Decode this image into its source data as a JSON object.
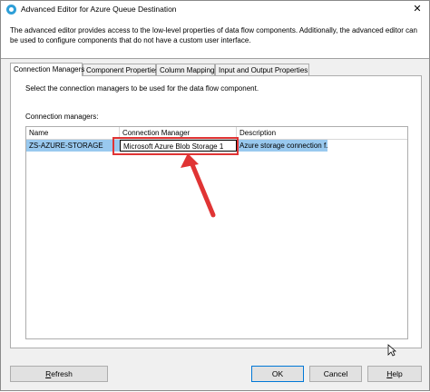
{
  "window": {
    "title": "Advanced Editor for Azure Queue Destination",
    "close_glyph": "✕"
  },
  "description": "The advanced editor provides access to the low-level properties of data flow components. Additionally, the advanced editor can be used to configure components that do not have a custom user interface.",
  "tabs": [
    {
      "label": "Connection Managers",
      "active": true
    },
    {
      "label": "Component Properties",
      "active": false
    },
    {
      "label": "Column Mappings",
      "active": false
    },
    {
      "label": "Input and Output Properties",
      "active": false
    }
  ],
  "panel": {
    "instruction": "Select the connection managers to be used for the data flow component.",
    "grid_label": "Connection managers:",
    "columns": [
      "Name",
      "Connection Manager",
      "Description"
    ],
    "rows": [
      {
        "name": "ZS-AZURE-STORAGE",
        "connection_manager": "Microsoft Azure Blob Storage 1",
        "description": "Azure storage connection f..."
      }
    ]
  },
  "buttons": {
    "refresh_pre": "",
    "refresh_u": "R",
    "refresh_post": "efresh",
    "ok": "OK",
    "cancel": "Cancel",
    "help_pre": "",
    "help_u": "H",
    "help_post": "elp"
  },
  "colors": {
    "selection": "#99c9ef",
    "annotation": "#e03434",
    "accent": "#0078d7"
  },
  "icons": {
    "app": "azure-queue-icon",
    "close": "close-icon",
    "cursor": "mouse-pointer-icon"
  }
}
